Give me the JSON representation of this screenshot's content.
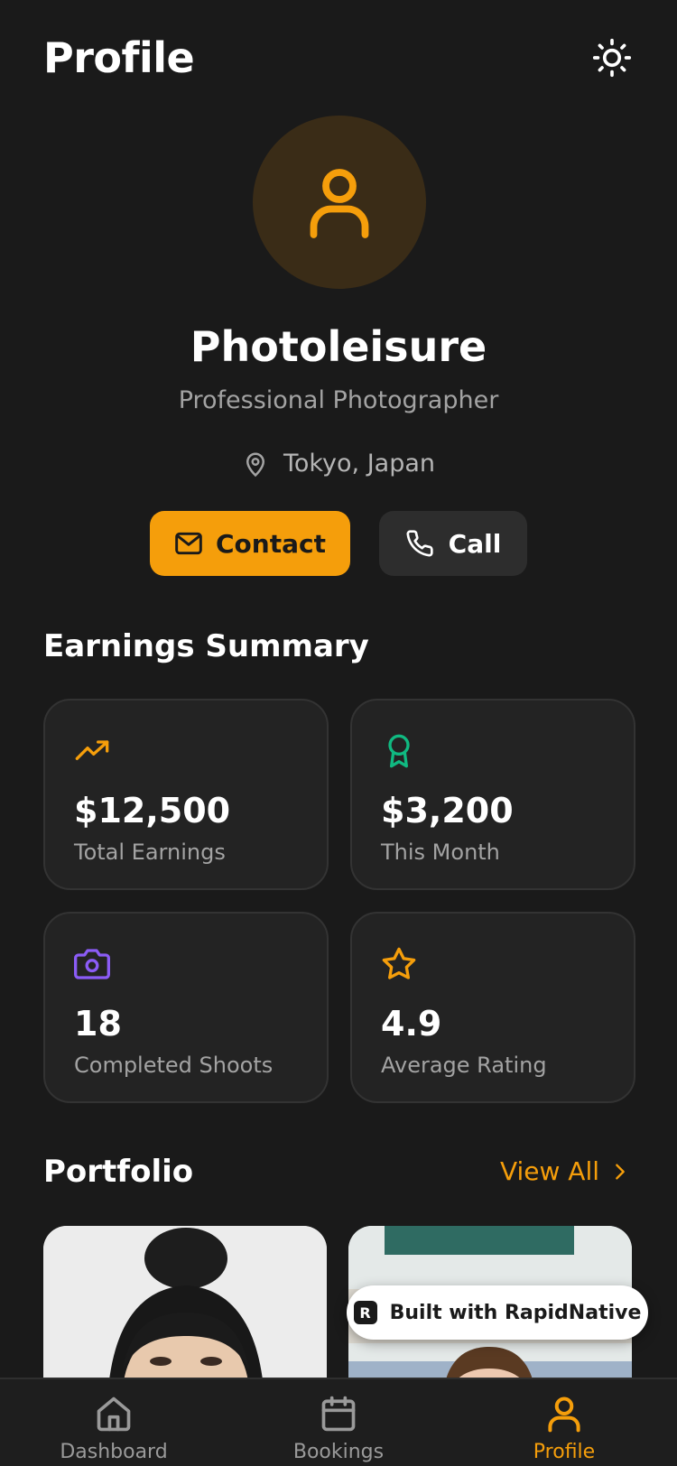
{
  "header": {
    "title": "Profile",
    "theme_icon": "sun-icon"
  },
  "profile": {
    "avatar_icon": "user-icon",
    "name": "Photoleisure",
    "profession": "Professional Photographer",
    "location": "Tokyo, Japan",
    "location_icon": "map-pin-icon"
  },
  "actions": {
    "contact_label": "Contact",
    "contact_icon": "mail-icon",
    "call_label": "Call",
    "call_icon": "phone-icon"
  },
  "earnings": {
    "title": "Earnings Summary",
    "cards": [
      {
        "value": "$12,500",
        "label": "Total Earnings",
        "icon": "trending-up-icon",
        "color": "#f59e0b"
      },
      {
        "value": "$3,200",
        "label": "This Month",
        "icon": "award-icon",
        "color": "#10b981"
      },
      {
        "value": "18",
        "label": "Completed Shoots",
        "icon": "camera-icon",
        "color": "#8b5cf6"
      },
      {
        "value": "4.9",
        "label": "Average Rating",
        "icon": "star-icon",
        "color": "#f59e0b"
      }
    ]
  },
  "portfolio": {
    "title": "Portfolio",
    "view_all": "View All",
    "photos": [
      "portfolio-photo-woman-hair-bun",
      "portfolio-photo-woman-classroom"
    ]
  },
  "badge": {
    "text": "Built with RapidNative",
    "logo": "R"
  },
  "tabs": [
    {
      "label": "Dashboard",
      "icon": "home-icon",
      "active": false
    },
    {
      "label": "Bookings",
      "icon": "calendar-icon",
      "active": false
    },
    {
      "label": "Profile",
      "icon": "user-icon",
      "active": true
    }
  ],
  "colors": {
    "background": "#1a1a1a",
    "accent": "#f59e0b",
    "card": "#232323",
    "muted_text": "#a3a3a3"
  }
}
